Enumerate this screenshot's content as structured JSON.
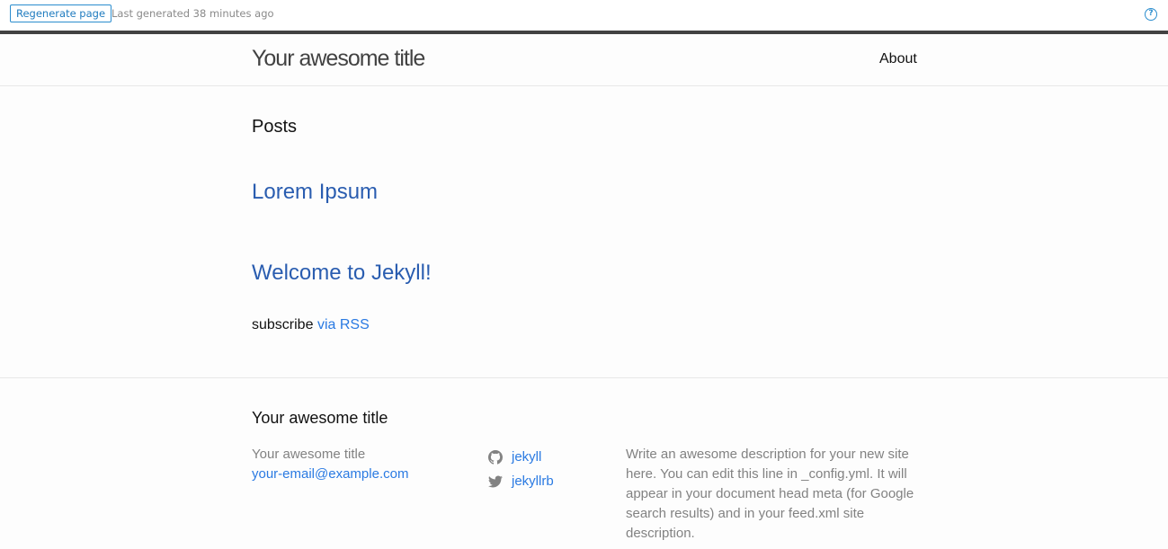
{
  "toolbar": {
    "regenerate_label": "Regenerate page",
    "last_generated": "Last generated 38 minutes ago",
    "help_glyph": "?"
  },
  "header": {
    "site_title": "Your awesome title",
    "nav": {
      "about_label": "About"
    }
  },
  "main": {
    "posts_heading": "Posts",
    "posts": [
      {
        "title": "Lorem Ipsum"
      },
      {
        "title": "Welcome to Jekyll!"
      }
    ],
    "subscribe_text": "subscribe",
    "rss_link": "via RSS"
  },
  "footer": {
    "heading": "Your awesome title",
    "site_name": "Your awesome title",
    "email": "your-email@example.com",
    "social": [
      {
        "icon": "github-icon",
        "label": "jekyll"
      },
      {
        "icon": "twitter-icon",
        "label": "jekyllrb"
      }
    ],
    "description": "Write an awesome description for your new site here. You can edit this line in _config.yml. It will appear in your document head meta (for Google search results) and in your feed.xml site description."
  },
  "colors": {
    "link": "#2a7ae2",
    "accent": "#2b8dce",
    "dark_bar": "#424242",
    "muted": "#828282"
  }
}
